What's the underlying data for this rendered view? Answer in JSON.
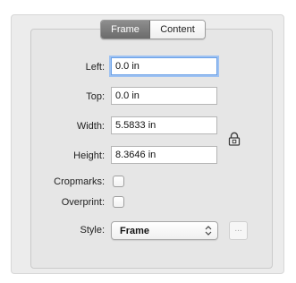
{
  "tabs": {
    "frame_label": "Frame",
    "content_label": "Content",
    "selected": "Frame"
  },
  "fields": {
    "left": {
      "label": "Left:",
      "value": "0.0 in"
    },
    "top": {
      "label": "Top:",
      "value": "0.0 in"
    },
    "width": {
      "label": "Width:",
      "value": "5.5833 in"
    },
    "height": {
      "label": "Height:",
      "value": "8.3646 in"
    }
  },
  "checkboxes": {
    "cropmarks": {
      "label": "Cropmarks:",
      "checked": false
    },
    "overprint": {
      "label": "Overprint:",
      "checked": false
    }
  },
  "style": {
    "label": "Style:",
    "value": "Frame"
  },
  "more_button": {
    "label": "..."
  },
  "icons": {
    "lock": "lock-icon",
    "select_arrows": "up-down-chevron-icon"
  },
  "colors": {
    "selected_tab": "#7a7a7a",
    "focus_ring": "#9ec2f2",
    "panel_bg": "#e6e6e6"
  }
}
